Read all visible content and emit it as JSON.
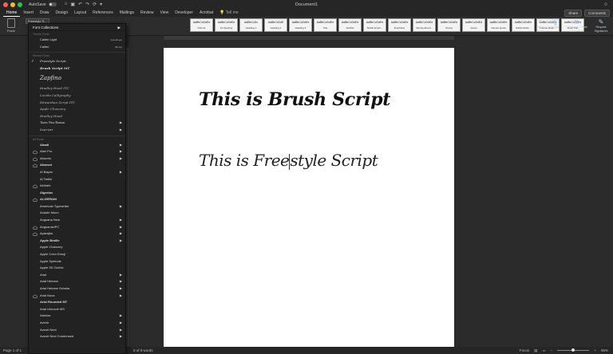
{
  "titlebar": {
    "autosave_label": "AutoSave",
    "autosave_state": "OFF",
    "doc_title": "Document1",
    "qat": [
      "⌂",
      "▣",
      "↶",
      "↷",
      "⟳",
      "▾"
    ]
  },
  "tabs": [
    "Home",
    "Insert",
    "Draw",
    "Design",
    "Layout",
    "References",
    "Mailings",
    "Review",
    "View",
    "Developer",
    "Acrobat"
  ],
  "tell_me": "Tell me",
  "share_label": "Share",
  "comments_label": "Comments",
  "ribbon": {
    "paste_label": "Paste",
    "font_value": "Freestyle S...",
    "styles": [
      {
        "sample": "AaBbCcDdEe",
        "name": "Normal"
      },
      {
        "sample": "AaBbCcDdEe",
        "name": "No Spacing"
      },
      {
        "sample": "AaBbCcDc",
        "name": "Heading 1"
      },
      {
        "sample": "AaBbCcDdE",
        "name": "Heading 2"
      },
      {
        "sample": "AaBbCcDdEe",
        "name": "Heading 3"
      },
      {
        "sample": "AaBbCcDdEe",
        "name": "Title"
      },
      {
        "sample": "AaBbCcDdEe",
        "name": "Subtitle"
      },
      {
        "sample": "AaBbCcDdEe",
        "name": "Subtle Emph..."
      },
      {
        "sample": "AaBbCcDdEe",
        "name": "Emphasis"
      },
      {
        "sample": "AaBbCcDdEe",
        "name": "Intense Emph..."
      },
      {
        "sample": "AaBbCcDdEe",
        "name": "Strong"
      },
      {
        "sample": "AaBbCcDdEe",
        "name": "Quote"
      },
      {
        "sample": "AaBbCcDdEe",
        "name": "Intense Quote"
      },
      {
        "sample": "AaBbCcDdEe",
        "name": "Subtle Refer..."
      },
      {
        "sample": "AaBbCcDdEe",
        "name": "Intense Refer..."
      },
      {
        "sample": "AaBbCcDdEe",
        "name": "Book Title"
      }
    ],
    "styles_pane": "Styles Pane",
    "dictate": "Dictate",
    "create_share": "Create and Share Adobe PDF",
    "request_signatures": "Request Signatures"
  },
  "font_menu": {
    "header": "Font Collections",
    "theme_fonts_label": "Theme Fonts",
    "theme_fonts": [
      {
        "name": "Calibri Light",
        "tag": "(Headings)"
      },
      {
        "name": "Calibri",
        "tag": "(Body)"
      }
    ],
    "recent_label": "Recent Fonts",
    "recent_fonts": [
      {
        "name": "Freestyle Script",
        "checked": "✓",
        "style": "freestyle"
      },
      {
        "name": "Brush Script MT",
        "checked": "",
        "style": "brush"
      },
      {
        "name": "Zapfino",
        "checked": "",
        "style": "zapfino"
      },
      {
        "name": "Bradley Hand ITC",
        "checked": "",
        "style": "plain"
      },
      {
        "name": "Lucida Calligraphy",
        "checked": "",
        "style": "plain"
      },
      {
        "name": "Edwardian Script ITC",
        "checked": "",
        "style": "plain"
      },
      {
        "name": "Apple Chancery",
        "checked": "",
        "style": "plain"
      },
      {
        "name": "Bradley Hand",
        "checked": "",
        "style": "plain"
      },
      {
        "name": "Times New Roman",
        "checked": "",
        "style": "serif",
        "submenu": "▶"
      },
      {
        "name": "Courier",
        "checked": "",
        "style": "mono",
        "submenu": "▶"
      }
    ],
    "all_label": "All Fonts",
    "all_fonts": [
      {
        "name": "Abadi",
        "cloud": false,
        "submenu": "▶",
        "bold": true
      },
      {
        "name": "Abel Pro",
        "cloud": true,
        "submenu": "▶"
      },
      {
        "name": "Aboreto",
        "cloud": true,
        "submenu": "▶"
      },
      {
        "name": "Aharoni",
        "cloud": true,
        "submenu": "",
        "bold": true
      },
      {
        "name": "Al Bayan",
        "cloud": false,
        "submenu": "▶"
      },
      {
        "name": "Al Tarikh",
        "cloud": false,
        "submenu": ""
      },
      {
        "name": "Aldhabi",
        "cloud": true,
        "submenu": ""
      },
      {
        "name": "Algerian",
        "cloud": false,
        "submenu": "",
        "bold": true
      },
      {
        "name": "ALGERIAN",
        "cloud": true,
        "submenu": "",
        "bold": true
      },
      {
        "name": "American Typewriter",
        "cloud": false,
        "submenu": "▶"
      },
      {
        "name": "Andale Mono",
        "cloud": false,
        "submenu": ""
      },
      {
        "name": "Angsana New",
        "cloud": false,
        "submenu": "▶"
      },
      {
        "name": "AngsanaUPC",
        "cloud": true,
        "submenu": "▶"
      },
      {
        "name": "Aparajita",
        "cloud": true,
        "submenu": "▶"
      },
      {
        "name": "Apple Braille",
        "cloud": false,
        "submenu": "▶",
        "bold": true
      },
      {
        "name": "Apple Chancery",
        "cloud": false,
        "submenu": ""
      },
      {
        "name": "Apple Color Emoji",
        "cloud": false,
        "submenu": ""
      },
      {
        "name": "Apple Symbols",
        "cloud": false,
        "submenu": ""
      },
      {
        "name": "Apple SD Gothic",
        "cloud": false,
        "submenu": ""
      },
      {
        "name": "Arial",
        "cloud": false,
        "submenu": "▶"
      },
      {
        "name": "Arial Hebrew",
        "cloud": false,
        "submenu": "▶"
      },
      {
        "name": "Arial Hebrew Scholar",
        "cloud": false,
        "submenu": "▶"
      },
      {
        "name": "Arial Nova",
        "cloud": true,
        "submenu": "▶"
      },
      {
        "name": "Arial Rounded MT",
        "cloud": false,
        "submenu": "",
        "bold": true
      },
      {
        "name": "Arial Unicode MS",
        "cloud": false,
        "submenu": ""
      },
      {
        "name": "Athelas",
        "cloud": false,
        "submenu": "▶"
      },
      {
        "name": "Avenir",
        "cloud": false,
        "submenu": "▶"
      },
      {
        "name": "Avenir Next",
        "cloud": false,
        "submenu": "▶"
      },
      {
        "name": "Avenir Next Condensed",
        "cloud": false,
        "submenu": "▶"
      }
    ]
  },
  "document": {
    "line1": "This is Brush Script",
    "line2_a": "This is Free",
    "line2_b": "style Script"
  },
  "status": {
    "page": "Page 1 of 1",
    "words": "8 of 8 words",
    "focus": "Focus",
    "zoom": "96%"
  }
}
